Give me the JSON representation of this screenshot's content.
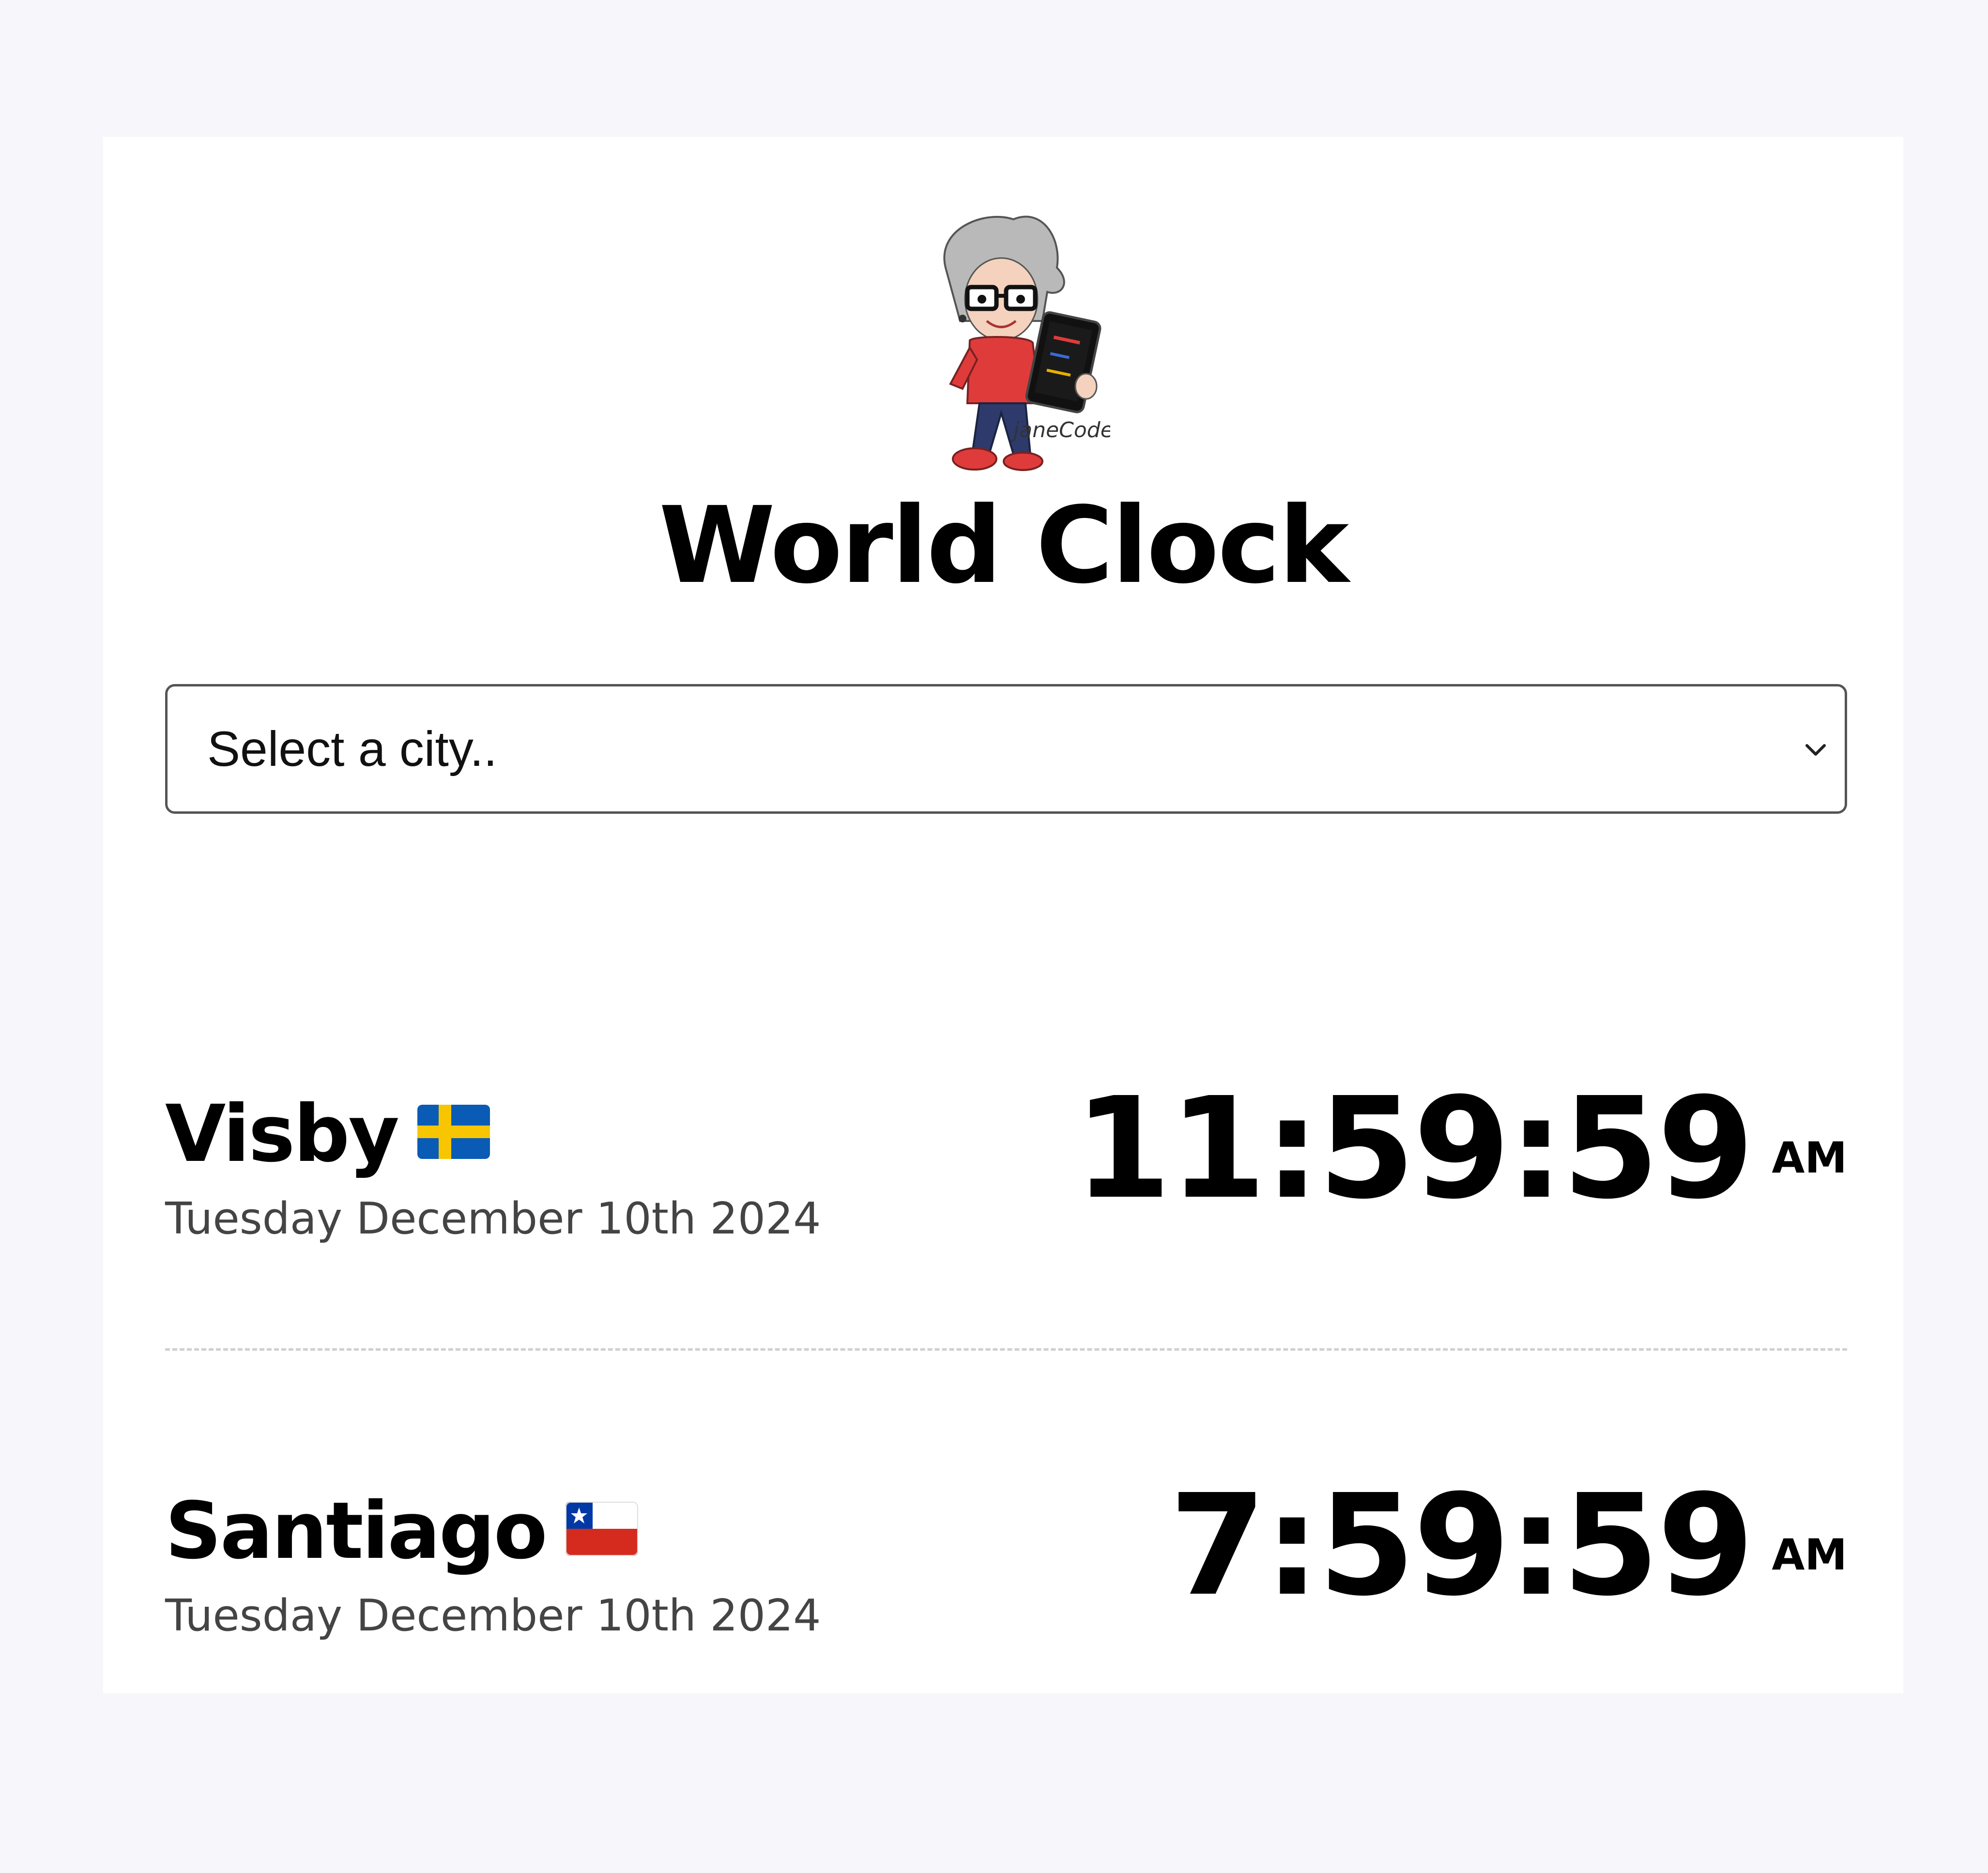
{
  "app": {
    "title": "World Clock",
    "logo_text": "janeCodes"
  },
  "city_select": {
    "value": "Select a city..",
    "icon": "chevron-down-icon"
  },
  "cities": [
    {
      "name": "Visby",
      "flag_icon": "sweden-flag-icon",
      "date": "Tuesday December 10th 2024",
      "time": "11:59:59",
      "ampm": "AM"
    },
    {
      "name": "Santiago",
      "flag_icon": "chile-flag-icon",
      "date": "Tuesday December 10th 2024",
      "time": "7:59:59",
      "ampm": "AM"
    }
  ],
  "colors": {
    "page_background": "#f7f7fb",
    "card_background": "#ffffff",
    "divider": "#cfcfcf",
    "date_text": "#444444"
  }
}
